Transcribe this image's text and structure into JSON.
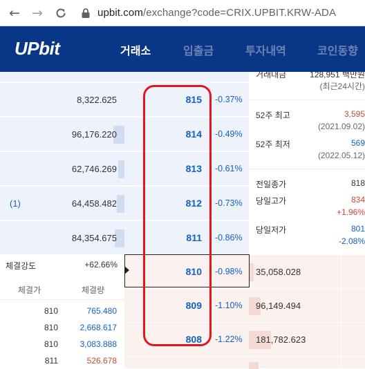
{
  "browser": {
    "url_host": "upbit.com",
    "url_path": "/exchange?code=CRIX.UPBIT.KRW-ADA"
  },
  "header": {
    "logo": "UPbit",
    "menu": [
      {
        "label": "거래소",
        "active": true
      },
      {
        "label": "입출금",
        "active": false
      },
      {
        "label": "투자내역",
        "active": false
      },
      {
        "label": "코인동향",
        "active": false
      }
    ]
  },
  "orderbook": {
    "asks": [
      {
        "volume": "8,322.625",
        "price": "815",
        "change": "-0.37%",
        "mark": "",
        "fill": 0.0
      },
      {
        "volume": "96,176.220",
        "price": "814",
        "change": "-0.49%",
        "mark": "",
        "fill": 0.09
      },
      {
        "volume": "62,746.269",
        "price": "813",
        "change": "-0.61%",
        "mark": "",
        "fill": 0.05
      },
      {
        "volume": "64,458.482",
        "price": "812",
        "change": "-0.73%",
        "mark": "(1)",
        "fill": 0.06
      },
      {
        "volume": "84,354.675",
        "price": "811",
        "change": "-0.86%",
        "mark": "",
        "fill": 0.08
      }
    ],
    "bids": [
      {
        "volume": "35,058.028",
        "price": "810",
        "change": "-0.98%",
        "fill": 0.04
      },
      {
        "volume": "96,149.494",
        "price": "809",
        "change": "-1.10%",
        "fill": 0.1
      },
      {
        "volume": "181,782.623",
        "price": "808",
        "change": "-1.22%",
        "fill": 0.19
      }
    ]
  },
  "info": {
    "volume_label": "거래대금",
    "volume_value": "128,951 백만원",
    "volume_sub": "(최근24시간)",
    "high52_label": "52주 최고",
    "high52_value": "3,595",
    "high52_date": "(2021.09.02)",
    "low52_label": "52주 최저",
    "low52_value": "569",
    "low52_date": "(2022.05.12)",
    "prev_close_label": "전일종가",
    "prev_close_value": "818",
    "day_high_label": "당일고가",
    "day_high_value": "834",
    "day_high_pct": "+1.96%",
    "day_low_label": "당일저가",
    "day_low_value": "801",
    "day_low_pct": "-2.08%"
  },
  "trades": {
    "strength_label": "체결강도",
    "strength_value": "+62.66%",
    "col_price": "체결가",
    "col_volume": "체결량",
    "rows": [
      {
        "price": "810",
        "volume": "765.480",
        "side": "ask"
      },
      {
        "price": "810",
        "volume": "2,668.617",
        "side": "ask"
      },
      {
        "price": "810",
        "volume": "3,083.888",
        "side": "ask"
      },
      {
        "price": "811",
        "volume": "526.678",
        "side": "bid"
      }
    ]
  },
  "colors": {
    "header_bg": "#093687",
    "ask_blue": "#1261c4",
    "bid_red": "#c84a31",
    "highlight": "#e4161b"
  }
}
